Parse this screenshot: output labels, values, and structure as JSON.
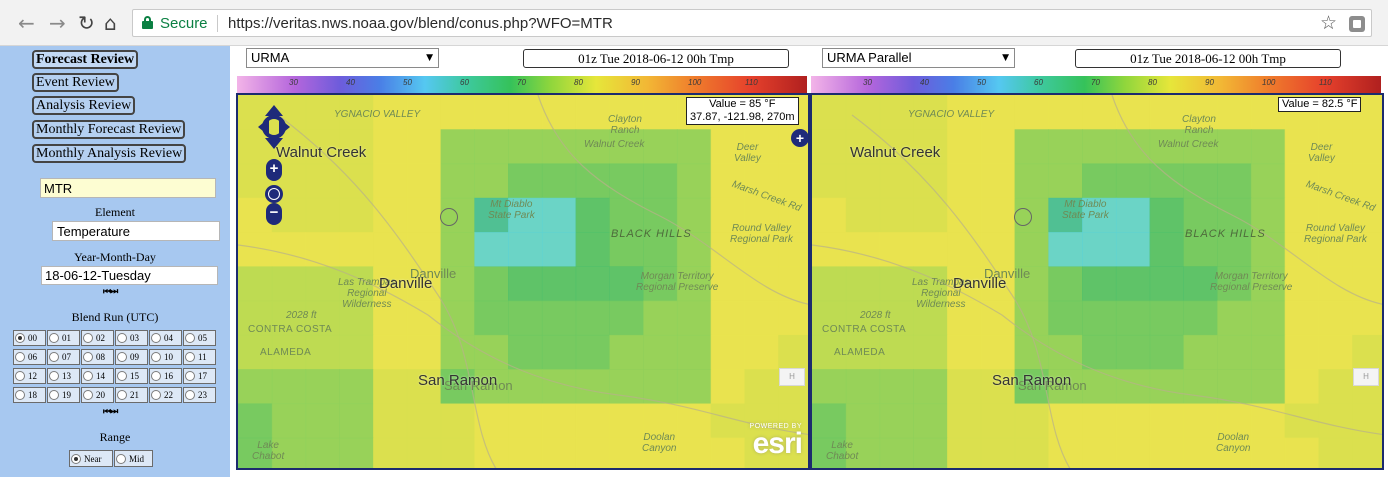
{
  "browser": {
    "secure_label": "Secure",
    "url": "https://veritas.nws.noaa.gov/blend/conus.php?WFO=MTR"
  },
  "sidebar": {
    "nav": [
      "Forecast Review",
      "Event Review",
      "Analysis Review",
      "Monthly Forecast Review",
      "Monthly Analysis Review"
    ],
    "wfo_value": "MTR",
    "element_label": "Element",
    "element_value": "Temperature",
    "date_label": "Year-Month-Day",
    "date_value": "18-06-12-Tuesday",
    "blend_run_label": "Blend Run (UTC)",
    "runs": [
      "00",
      "01",
      "02",
      "03",
      "04",
      "05",
      "06",
      "07",
      "08",
      "09",
      "10",
      "11",
      "12",
      "13",
      "14",
      "15",
      "16",
      "17",
      "18",
      "19",
      "20",
      "21",
      "22",
      "23"
    ],
    "selected_run": "00",
    "range_label": "Range",
    "range_options": [
      "Near",
      "Mid"
    ],
    "selected_range": "Near"
  },
  "panels": [
    {
      "model": "URMA",
      "time": "01z Tue 2018-06-12 00h Tmp",
      "value_text": "Value = 85 °F",
      "coords_text": "37.87, -121.98, 270m"
    },
    {
      "model": "URMA Parallel",
      "time": "01z Tue 2018-06-12 00h Tmp",
      "value_text": "Value = 82.5 °F"
    }
  ],
  "colorbar_ticks": [
    "30",
    "40",
    "50",
    "60",
    "70",
    "80",
    "90",
    "100",
    "110"
  ],
  "map_labels": {
    "walnut_creek": "Walnut Creek",
    "walnut_creek_base": "Walnut Creek",
    "danville": "Danville",
    "danville_base": "Danville",
    "san_ramon": "San Ramon",
    "san_ramon_base": "San Ramon",
    "ygnacio": "YGNACIO VALLEY",
    "clayton": "Clayton\nRanch",
    "deer_valley": "Deer\nValley",
    "marsh_creek": "Marsh Creek Rd",
    "mt_diablo": "Mt Diablo\nState Park",
    "black_hills": "BLACK HILLS",
    "round_valley": "Round Valley\nRegional Park",
    "morgan": "Morgan Territory\nRegional Preserve",
    "las_trampas": "Las Trampas\nRegional\nWilderness",
    "contra_costa": "CONTRA COSTA",
    "alameda": "ALAMEDA",
    "elev": "2028 ft",
    "lake_chabot": "Lake\nChabot",
    "doolan": "Doolan\nCanyon",
    "h_btn": "H",
    "powered_by": "POWERED BY",
    "esri": "esri"
  },
  "colors": {
    "sidebar_bg": "#a7c8f0",
    "map_border": "#1c2b6e",
    "control_blue": "#1e2a7a",
    "secure_green": "#0b8043"
  }
}
